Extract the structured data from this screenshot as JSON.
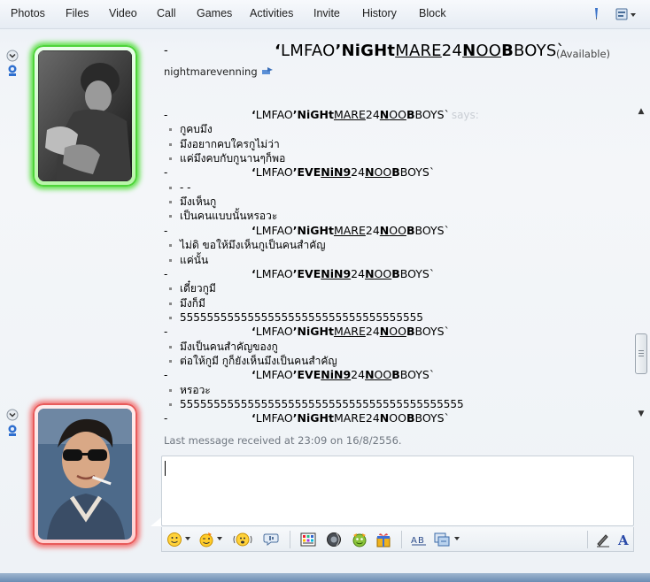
{
  "menu": {
    "items": [
      "Photos",
      "Files",
      "Video",
      "Call",
      "Games",
      "Activities",
      "Invite",
      "History",
      "Block"
    ]
  },
  "header": {
    "dash": "-",
    "name_parts": [
      "‘",
      "L",
      "M",
      "F",
      "A",
      "O",
      "’",
      "NiGHt",
      "MARE",
      "24",
      "N",
      "OO",
      "B",
      "BOYS",
      "`"
    ],
    "status": "(Available)",
    "subtitle": "nightmarevenning"
  },
  "conversation": {
    "says": "says:",
    "dash": "-",
    "senders": {
      "nightmare": [
        "‘",
        "L",
        "M",
        "F",
        "A",
        "O",
        "’",
        "NiGHt",
        "MARE",
        "24",
        "N",
        "OO",
        "B",
        "BOYS",
        "`"
      ],
      "evening": [
        "‘",
        "L",
        "M",
        "F",
        "A",
        "O",
        "’",
        "EVE",
        "NiN9",
        "24",
        "N",
        "OO",
        "B",
        "BOYS",
        "`"
      ]
    },
    "lines": [
      {
        "kind": "sender",
        "who": "nightmare",
        "says": true
      },
      {
        "kind": "msg",
        "text": "กูคบมึง"
      },
      {
        "kind": "msg",
        "text": "มึงอยากคบใครกูไม่ว่า"
      },
      {
        "kind": "msg",
        "text": "แค่มึงคบกับกูนานๆก็พอ"
      },
      {
        "kind": "sender",
        "who": "evening",
        "says": false
      },
      {
        "kind": "msg",
        "text": "- -"
      },
      {
        "kind": "msg",
        "text": "มึงเห็นกู"
      },
      {
        "kind": "msg",
        "text": "เป็นคนแบบนั้นหรอวะ"
      },
      {
        "kind": "sender",
        "who": "nightmare",
        "says": false
      },
      {
        "kind": "msg",
        "text": "ไม่ดิ ขอให้มึงเห็นกูเป็นคนสำคัญ"
      },
      {
        "kind": "msg",
        "text": "แค่นั้น"
      },
      {
        "kind": "sender",
        "who": "evening",
        "says": false
      },
      {
        "kind": "msg",
        "text": "เดี๋ยวกูมี"
      },
      {
        "kind": "msg",
        "text": "มึงก็มี"
      },
      {
        "kind": "msg",
        "text": "555555555555555555555555555555555555"
      },
      {
        "kind": "sender",
        "who": "nightmare",
        "says": false
      },
      {
        "kind": "msg",
        "text": "มึงเป็นคนสำคัญของกู"
      },
      {
        "kind": "msg",
        "text": "ต่อให้กูมี กูก็ยังเห็นมึงเป็นคนสำคัญ"
      },
      {
        "kind": "sender",
        "who": "evening",
        "says": false
      },
      {
        "kind": "msg",
        "text": "หรอวะ"
      },
      {
        "kind": "msg",
        "text": "555555555555555555555555555555555555555555"
      },
      {
        "kind": "sender",
        "who": "nightmare",
        "says": false
      }
    ],
    "last_message": "Last message received at 23:09 on 16/8/2556."
  },
  "icons": {
    "sidebar": [
      "chevron-down-icon",
      "webcam-icon"
    ],
    "toolbar_top": [
      "pen-icon",
      "settings-menu-icon"
    ],
    "input_toolbar": [
      "emoticon-icon",
      "wink-icon",
      "nudge-icon",
      "voice-clip-icon",
      "background-icon",
      "sound-icon",
      "games-icon",
      "gift-icon",
      "font-icon",
      "ink-icon",
      "handwriting-icon",
      "text-icon"
    ]
  },
  "colors": {
    "contact_frame": "#5fe04a",
    "self_frame": "#e85b5b",
    "says_text": "#c9ced4",
    "last_message_text": "#6f7780"
  }
}
